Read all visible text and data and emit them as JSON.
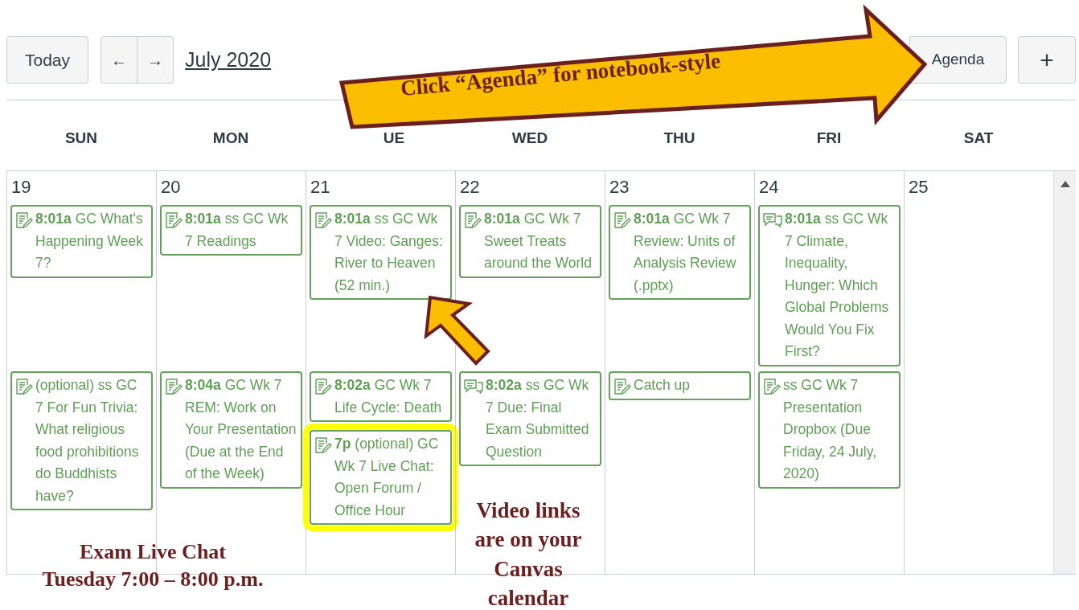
{
  "toolbar": {
    "today": "Today",
    "prev": "←",
    "next": "→",
    "month": "July 2020",
    "views": [
      {
        "label": "Agenda",
        "selected": false
      }
    ],
    "add": "+"
  },
  "weekdays": [
    "SUN",
    "MON",
    "UE",
    "WED",
    "THU",
    "FRI",
    "SAT"
  ],
  "days": [
    {
      "date": "19",
      "events": [
        {
          "kind": "assignment",
          "highlighted": false,
          "text": "**8:01a** GC What's Happening Week 7?"
        },
        {
          "kind": "assignment",
          "highlighted": false,
          "text": "(optional) ss GC 7 For Fun Trivia: What religious food prohibitions do Buddhists have?"
        }
      ]
    },
    {
      "date": "20",
      "events": [
        {
          "kind": "assignment",
          "highlighted": false,
          "text": "**8:01a** ss GC Wk 7 Readings"
        },
        {
          "kind": "assignment",
          "highlighted": false,
          "text": "**8:04a** GC Wk 7 REM: Work on Your Presentation (Due at the End of the Week)"
        }
      ]
    },
    {
      "date": "21",
      "events": [
        {
          "kind": "assignment",
          "highlighted": false,
          "text": "**8:01a** ss GC Wk 7 Video: Ganges: River to Heaven (52 min.)"
        },
        {
          "kind": "assignment",
          "highlighted": false,
          "text": "**8:02a** GC Wk 7 Life Cycle: Death"
        },
        {
          "kind": "assignment",
          "highlighted": true,
          "text": "**7p** (optional) GC Wk 7 Live Chat: Open Forum / Office Hour"
        }
      ]
    },
    {
      "date": "22",
      "events": [
        {
          "kind": "assignment",
          "highlighted": false,
          "text": "**8:01a** GC Wk 7 Sweet Treats around the World"
        },
        {
          "kind": "discussion",
          "highlighted": false,
          "text": "**8:02a** ss GC Wk 7 Due: Final Exam Submitted Question"
        }
      ]
    },
    {
      "date": "23",
      "events": [
        {
          "kind": "assignment",
          "highlighted": false,
          "text": "**8:01a** GC Wk 7 Review: Units of Analysis Review (.pptx)"
        },
        {
          "kind": "assignment",
          "highlighted": false,
          "text": "Catch up"
        }
      ]
    },
    {
      "date": "24",
      "events": [
        {
          "kind": "discussion",
          "highlighted": false,
          "text": "**8:01a** ss GC Wk 7 Climate, Inequality, Hunger: Which Global Problems Would You Fix First?"
        },
        {
          "kind": "assignment",
          "highlighted": false,
          "text": "ss GC Wk 7 Presentation Dropbox (Due Friday, 24 July, 2020)"
        }
      ]
    },
    {
      "date": "25"
    }
  ],
  "annotations": {
    "callout": "Click “Agenda” for notebook-style",
    "exam_note": [
      "Exam Live Chat",
      "Tuesday 7:00 – 8:00 p.m."
    ],
    "video_note": "Video links are on your Canvas calendar"
  }
}
